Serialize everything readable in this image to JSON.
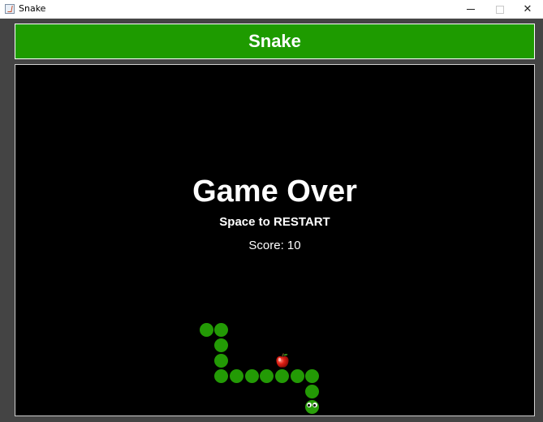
{
  "window": {
    "title": "Snake",
    "controls": {
      "minimize": "minimize",
      "maximize": "maximize",
      "close": "close"
    }
  },
  "header": {
    "title": "Snake"
  },
  "game": {
    "status": "Game Over",
    "instruction": "Space to RESTART",
    "score_label": "Score:",
    "score_value": 10,
    "snake_color": "#239a05",
    "food": "apple-icon"
  },
  "colors": {
    "header_bg": "#1e9b00",
    "frame_bg": "#444444",
    "board_bg": "#000000",
    "text": "#ffffff"
  }
}
